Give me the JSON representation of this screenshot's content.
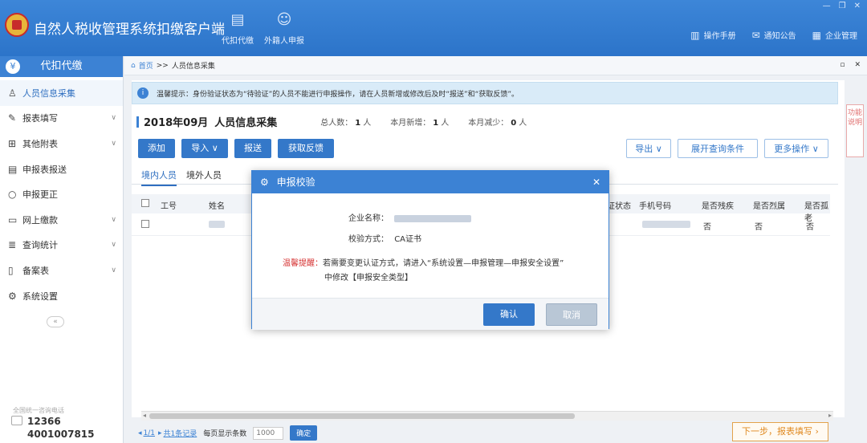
{
  "app": {
    "title": "自然人税收管理系统扣缴客户端",
    "tools": [
      {
        "label": "代扣代缴",
        "icon": "document-icon"
      },
      {
        "label": "外籍人申报",
        "icon": "foreign-person-icon"
      }
    ],
    "links": [
      {
        "label": "操作手册",
        "icon": "manual-icon"
      },
      {
        "label": "通知公告",
        "icon": "mail-icon"
      },
      {
        "label": "企业管理",
        "icon": "building-icon"
      }
    ]
  },
  "sidebar": {
    "header": "代扣代缴",
    "items": [
      {
        "label": "人员信息采集",
        "icon": "person-icon",
        "active": true,
        "has_sub": false
      },
      {
        "label": "报表填写",
        "icon": "edit-icon",
        "active": false,
        "has_sub": true
      },
      {
        "label": "其他附表",
        "icon": "grid-icon",
        "active": false,
        "has_sub": true
      },
      {
        "label": "申报表报送",
        "icon": "report-send-icon",
        "active": false,
        "has_sub": false
      },
      {
        "label": "申报更正",
        "icon": "search-icon",
        "active": false,
        "has_sub": false
      },
      {
        "label": "网上缴款",
        "icon": "folder-icon",
        "active": false,
        "has_sub": true
      },
      {
        "label": "查询统计",
        "icon": "query-icon",
        "active": false,
        "has_sub": true
      },
      {
        "label": "备案表",
        "icon": "file-icon",
        "active": false,
        "has_sub": true
      },
      {
        "label": "系统设置",
        "icon": "gear-icon",
        "active": false,
        "has_sub": false
      }
    ],
    "hotline_label": "全国统一咨询电话",
    "hotline1": "12366",
    "hotline2": "4001007815"
  },
  "breadcrumb": {
    "home": "首页",
    "sep": ">>",
    "current": "人员信息采集"
  },
  "main": {
    "tip": "温馨提示：身份验证状态为“待验证”的人员不能进行申报操作，请在人员新增或修改后及时“报送”和“获取反馈”。",
    "period": "2018年09月",
    "title": "人员信息采集",
    "stats": [
      {
        "label": "总人数：",
        "value": "1",
        "unit": "人"
      },
      {
        "label": "本月新增：",
        "value": "1",
        "unit": "人"
      },
      {
        "label": "本月减少：",
        "value": "0",
        "unit": "人"
      }
    ],
    "buttons": {
      "add": "添加",
      "import": "导入",
      "submit": "报送",
      "feedback": "获取反馈",
      "export": "导出",
      "expand": "展开查询条件",
      "more": "更多操作"
    },
    "tabs": [
      "境内人员",
      "境外人员"
    ],
    "columns": {
      "id": "工号",
      "name": "姓名",
      "status_tail": "证状态",
      "phone": "手机号码",
      "disabled": "是否残疾",
      "martyr": "是否烈属",
      "elder": "是否孤老"
    },
    "rows": [
      {
        "disabled": "否",
        "martyr": "否",
        "elder": "否"
      }
    ],
    "side_note": "功能说明"
  },
  "pager": {
    "pages": "1/1",
    "total": "共1条记录",
    "per_page_label": "每页显示条数",
    "per_page_value": "1000",
    "confirm": "确定"
  },
  "next_step": "下一步，报表填写",
  "dialog": {
    "title": "申报校验",
    "company_label": "企业名称：",
    "method_label": "校验方式：",
    "method_value": "CA证书",
    "warn_red": "温馨提醒：",
    "warn_text1": "若需要变更认证方式，请进入“系统设置—申报管理—申报安全设置”",
    "warn_text2": "中修改【申报安全类型】",
    "ok": "确认",
    "cancel": "取消"
  }
}
